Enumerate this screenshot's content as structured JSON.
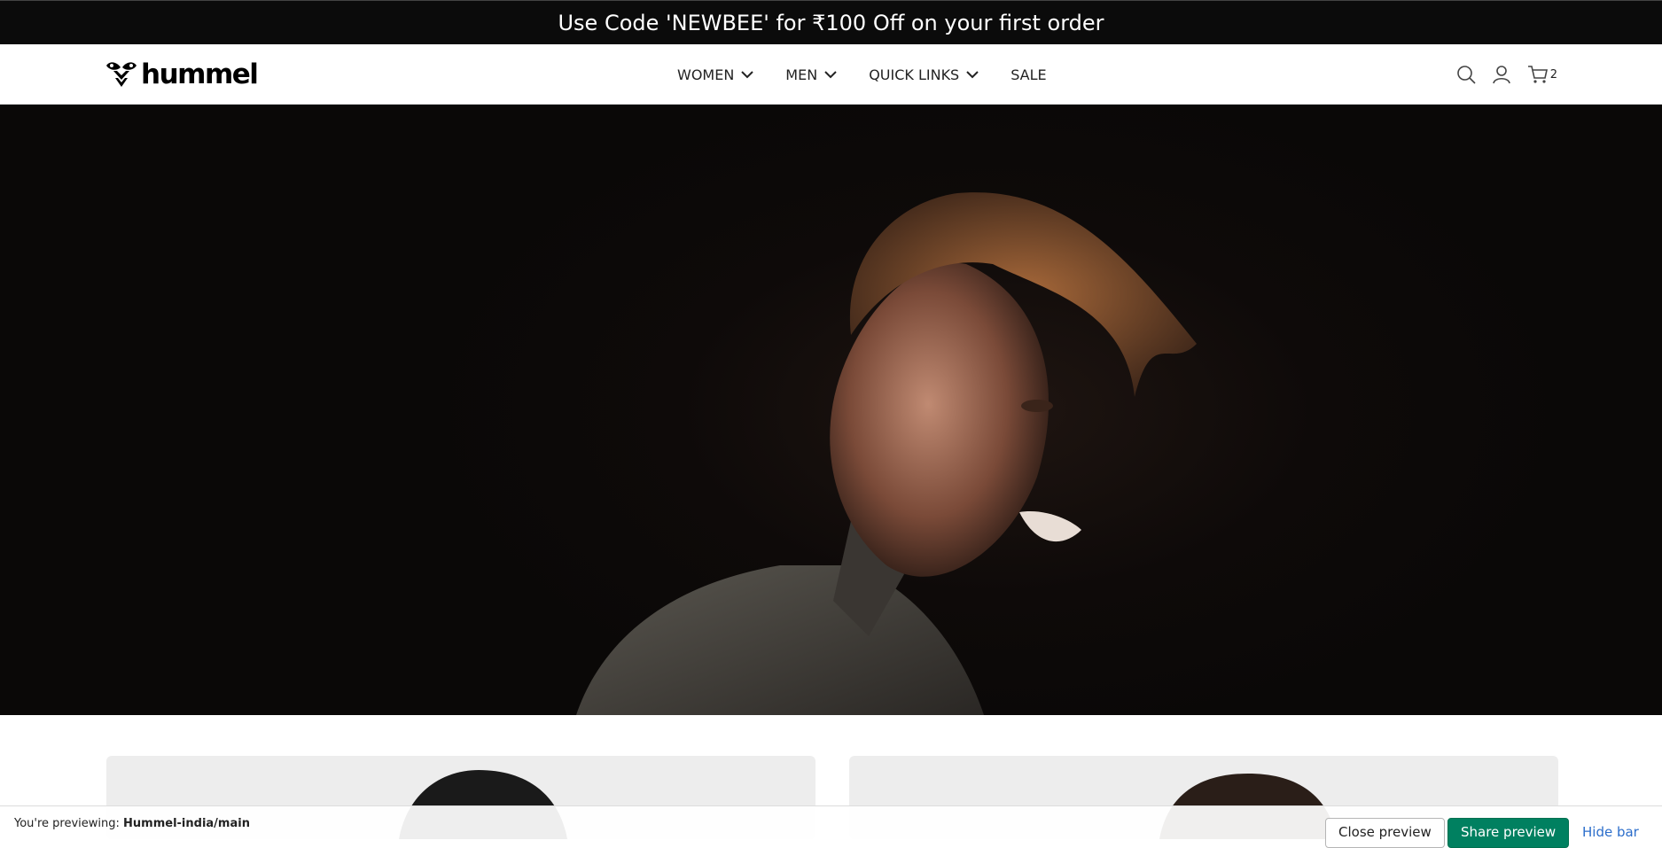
{
  "announcement": {
    "text": "Use Code 'NEWBEE' for ₹100 Off on your first order"
  },
  "header": {
    "logo_text": "hummel",
    "nav": [
      {
        "label": "WOMEN",
        "has_dropdown": true
      },
      {
        "label": "MEN",
        "has_dropdown": true
      },
      {
        "label": "QUICK LINKS",
        "has_dropdown": true
      },
      {
        "label": "SALE",
        "has_dropdown": false
      }
    ],
    "icons": [
      "search-icon",
      "account-icon",
      "cart-icon"
    ],
    "cart_count": "2"
  },
  "hero": {
    "media": "video-still-person-in-dark"
  },
  "preview_bar": {
    "label": "You're previewing: ",
    "theme_name": "Hummel-india/main",
    "close_label": "Close preview",
    "share_label": "Share preview",
    "hide_label": "Hide bar"
  },
  "colors": {
    "announcement_bg": "#0b0b0b",
    "share_button": "#008060",
    "link": "#2c6ecb"
  }
}
